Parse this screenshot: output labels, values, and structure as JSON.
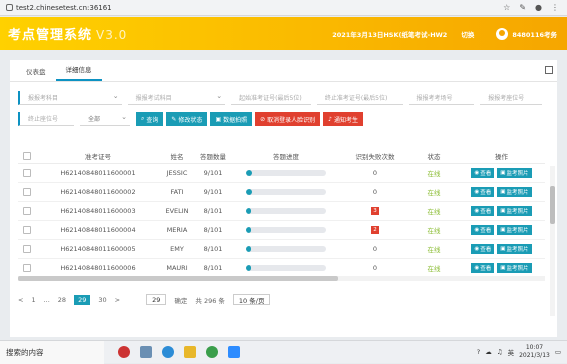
{
  "browser": {
    "url": "test2.chinesetest.cn:36161"
  },
  "app": {
    "title": "考点管理系统",
    "version": "V3.0",
    "exam_info": "2021年3月13日HSK(纸笔考试-HW2",
    "switch_label": "切换",
    "user": "8480116考务",
    "colors": {
      "accent": "#f6a600",
      "primary": "#1a9cb5",
      "danger": "#e0402f",
      "online": "#8bbd34"
    }
  },
  "tabs": [
    {
      "label": "仪表盘"
    },
    {
      "label": "详细信息",
      "active": true
    }
  ],
  "filters": {
    "row1": [
      "报报考科目",
      "报报考试科目",
      "起始准考证号(最后5位)",
      "终止准考证号(最后5位)",
      "报报考考场号",
      "报报考座位号"
    ],
    "row2": [
      "终止座位号",
      "全部"
    ],
    "buttons": [
      "查询",
      "修改状态",
      "数据拍照",
      "取消登录人脸识别",
      "通知考生"
    ]
  },
  "table": {
    "headers": [
      "准考证号",
      "姓名",
      "答题数量",
      "答题进度",
      "识别失败次数",
      "状态",
      "操作"
    ],
    "rows": [
      {
        "id": "H62140848011600001",
        "name": "JESSIC",
        "count": "9/101",
        "progress": 0.07,
        "fail": "0",
        "fail_alert": false,
        "status": "在线"
      },
      {
        "id": "H62140848011600002",
        "name": "FATI",
        "count": "9/101",
        "progress": 0.07,
        "fail": "0",
        "fail_alert": false,
        "status": "在线"
      },
      {
        "id": "H62140848011600003",
        "name": "EVELIN",
        "count": "8/101",
        "progress": 0.06,
        "fail": "3",
        "fail_alert": true,
        "status": "在线"
      },
      {
        "id": "H62140848011600004",
        "name": "MERIA",
        "count": "8/101",
        "progress": 0.06,
        "fail": "2",
        "fail_alert": true,
        "status": "在线"
      },
      {
        "id": "H62140848011600005",
        "name": "EMY",
        "count": "8/101",
        "progress": 0.06,
        "fail": "0",
        "fail_alert": false,
        "status": "在线"
      },
      {
        "id": "H62140848011600006",
        "name": "MAURI",
        "count": "8/101",
        "progress": 0.06,
        "fail": "0",
        "fail_alert": false,
        "status": "在线"
      }
    ],
    "action_view": "查看",
    "action_photo": "监考照片"
  },
  "pager": {
    "prev": "<",
    "first": "1",
    "ellipsis": "...",
    "p28": "28",
    "current": "29",
    "p30": "30",
    "next": ">",
    "goto_value": "29",
    "goto_label": "确定",
    "total": "共 296 条",
    "page_size": "10 条/页"
  },
  "taskbar": {
    "search": "搜索的内容",
    "ime": "英",
    "time": "10:07",
    "date": "2021/3/13"
  }
}
